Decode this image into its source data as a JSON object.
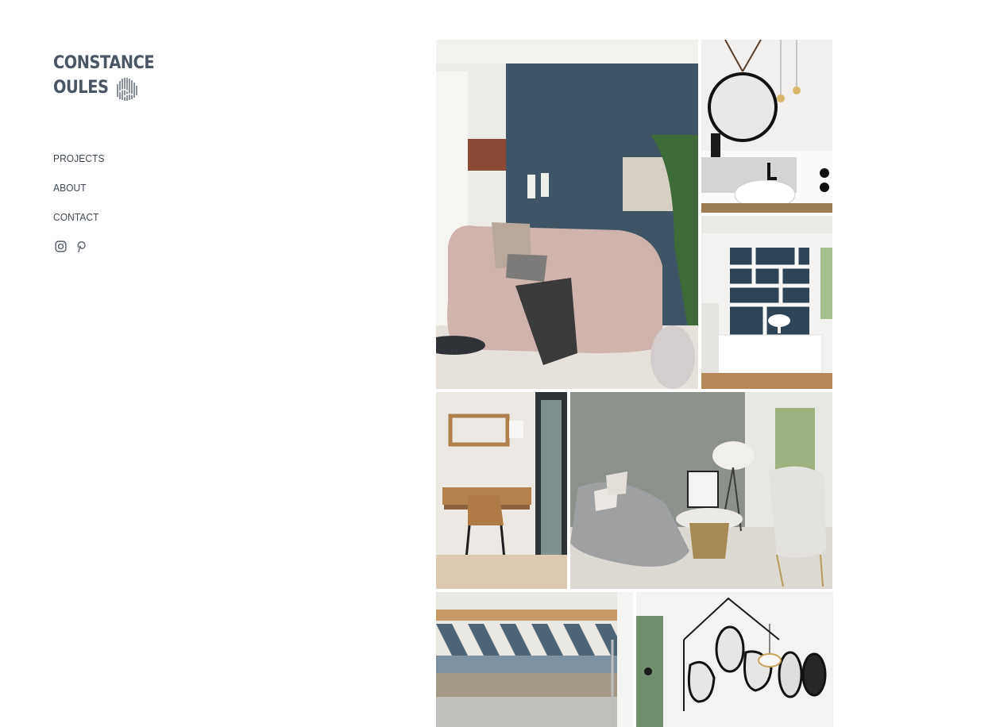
{
  "brand": {
    "line1": "CONSTANCE",
    "line2": "OULES",
    "color": "#4a5663"
  },
  "nav": {
    "items": [
      {
        "label": "PROJECTS"
      },
      {
        "label": "ABOUT"
      },
      {
        "label": "CONTACT"
      }
    ]
  },
  "social": {
    "icons": [
      "instagram-icon",
      "pinterest-icon"
    ]
  },
  "gallery": {
    "photos": [
      {
        "subject": "living-room-pink-sofa-blue-wall"
      },
      {
        "subject": "bathroom-round-mirror-vessel-sink"
      },
      {
        "subject": "white-shelving-dark-blue-wall-lamp"
      },
      {
        "subject": "wooden-desk-shelf-chair"
      },
      {
        "subject": "grey-sofa-living-room-floor-lamp"
      },
      {
        "subject": "patterned-tile-shower"
      },
      {
        "subject": "wall-mirrors-pendant-lamp"
      }
    ]
  },
  "colors": {
    "nav_text": "#3f4852",
    "accent_blue": "#3d4d5c",
    "background": "#ffffff"
  }
}
